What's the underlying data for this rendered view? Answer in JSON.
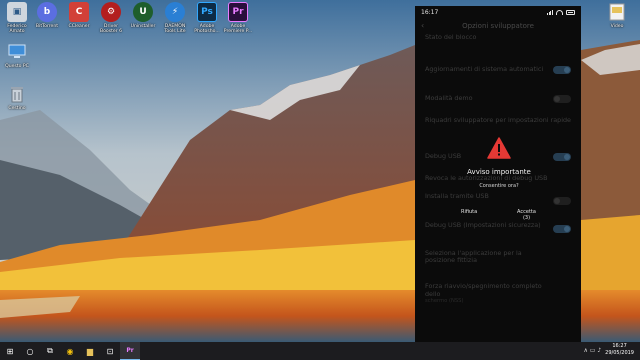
{
  "desktop": {
    "icons": [
      {
        "label": "Federico\nAmato",
        "glyph": "▣",
        "color": "#cfd6de",
        "icon": "folder-user-icon"
      },
      {
        "label": "BitTorrent",
        "glyph": "b",
        "color": "#5b6ee1",
        "icon": "bittorrent-icon"
      },
      {
        "label": "CCleaner",
        "glyph": "C",
        "color": "#d24038",
        "icon": "ccleaner-icon"
      },
      {
        "label": "Driver\nBooster 6",
        "glyph": "⚙",
        "color": "#b31e1e",
        "icon": "driver-booster-icon"
      },
      {
        "label": "Uninstaller",
        "glyph": "U",
        "color": "#1e5e2c",
        "icon": "uninstaller-icon"
      },
      {
        "label": "DAEMON\nTools Lite",
        "glyph": "⚡",
        "color": "#2a7fd4",
        "icon": "daemon-tools-icon"
      },
      {
        "label": "Adobe\nPhotosho...",
        "glyph": "Ps",
        "color": "#0d2b45",
        "icon": "photoshop-icon"
      },
      {
        "label": "Adobe\nPremiere P...",
        "glyph": "Pr",
        "color": "#2a0f3d",
        "icon": "premiere-icon"
      },
      {
        "label": "Questo PC",
        "glyph": "🖥",
        "color": "#3f8ed8",
        "icon": "this-pc-icon"
      },
      {
        "label": "Cestino",
        "glyph": "🗑",
        "color": "#9aa5b1",
        "icon": "recycle-bin-icon"
      },
      {
        "label": "Video",
        "glyph": "▤",
        "color": "#e6c25b",
        "icon": "folder-icon"
      }
    ]
  },
  "phone": {
    "status": {
      "time": "16:17"
    },
    "header": {
      "title": "Opzioni sviluppatore",
      "back_glyph": "‹"
    },
    "settings": [
      {
        "label": "Stato del blocco",
        "sub": "",
        "toggle": ""
      },
      {
        "label": "Aggiornamenti di sistema automatici",
        "sub": "",
        "toggle": "on"
      },
      {
        "label": "Modalità demo",
        "sub": "",
        "toggle": "off"
      },
      {
        "label": "Riquadri sviluppatore per impostazioni rapide",
        "sub": "",
        "toggle": ""
      },
      {
        "label": "Debug USB",
        "sub": "",
        "toggle": "on"
      },
      {
        "label": "Revoca le autorizzazioni di debug USB",
        "sub": "",
        "toggle": ""
      },
      {
        "label": "Installa tramite USB",
        "sub": "",
        "toggle": "off"
      },
      {
        "label": "Debug USB (Impostazioni sicurezza)",
        "sub": "",
        "toggle": "on"
      },
      {
        "label": "Seleziona l'applicazione per la posizione fittizia",
        "sub": "",
        "toggle": ""
      },
      {
        "label": "Forza riavvio/spegnimento completo dello",
        "sub": "schermo (NSS)",
        "toggle": ""
      }
    ],
    "dialog": {
      "title": "Avviso importante",
      "message": "Consentire ora?",
      "reject": "Rifiuta",
      "accept": "Accetta (3)",
      "warning_color": "#e53935"
    }
  },
  "taskbar": {
    "start_glyph": "⊞",
    "items": [
      {
        "glyph": "○",
        "icon": "search-icon"
      },
      {
        "glyph": "⧉",
        "icon": "task-view-icon"
      },
      {
        "glyph": "◉",
        "icon": "chrome-icon"
      },
      {
        "glyph": "▆",
        "icon": "file-explorer-icon"
      },
      {
        "glyph": "⊡",
        "icon": "store-icon"
      },
      {
        "glyph": "Pr",
        "icon": "premiere-taskbar-icon"
      }
    ],
    "tray_glyph": "∧ ▭ ♪",
    "time": "16:27",
    "date": "29/05/2019"
  }
}
